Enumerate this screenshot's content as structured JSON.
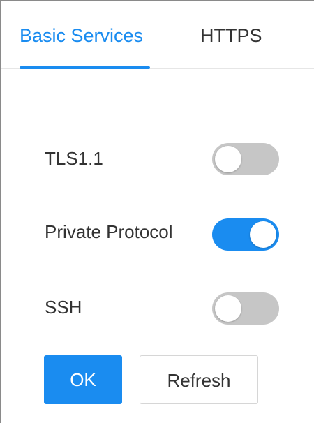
{
  "tabs": [
    {
      "label": "Basic Services",
      "active": true
    },
    {
      "label": "HTTPS",
      "active": false
    }
  ],
  "settings": [
    {
      "label": "TLS1.1",
      "enabled": false
    },
    {
      "label": "Private Protocol",
      "enabled": true
    },
    {
      "label": "SSH",
      "enabled": false
    }
  ],
  "buttons": {
    "ok_label": "OK",
    "refresh_label": "Refresh"
  },
  "colors": {
    "accent": "#1a8cf0",
    "toggle_off": "#c6c6c6",
    "text": "#333333"
  }
}
